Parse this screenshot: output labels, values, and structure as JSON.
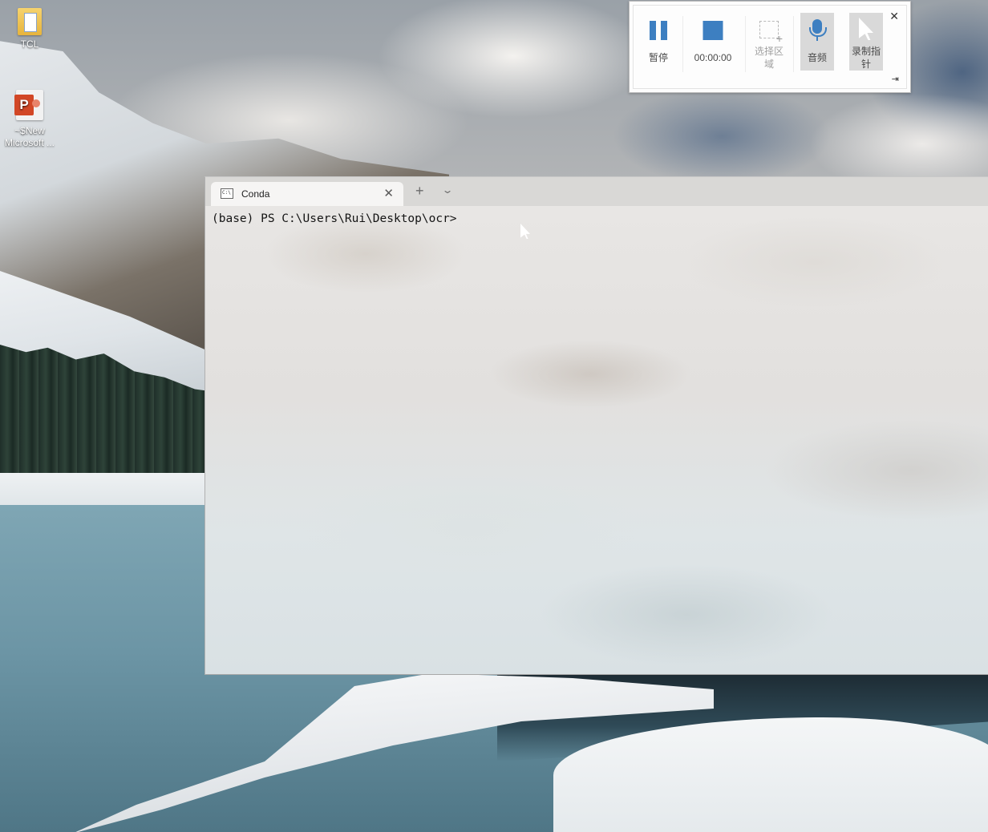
{
  "desktop": {
    "icons": [
      {
        "label": "TCL"
      },
      {
        "label_line1": "~$New",
        "label_line2": "Microsoft ..."
      }
    ]
  },
  "recorder": {
    "pause_label": "暂停",
    "timer": "00:00:00",
    "select_region_line1": "选择区",
    "select_region_line2": "域",
    "audio_label": "音频",
    "record_pointer_line1": "录制指",
    "record_pointer_line2": "针",
    "close_glyph": "✕",
    "pin_glyph": "⇥"
  },
  "terminal": {
    "tab_title": "Conda",
    "tab_icon_text": "C:\\",
    "tab_close_glyph": "✕",
    "new_tab_glyph": "+",
    "dropdown_glyph": "⌄",
    "prompt": "(base) PS C:\\Users\\Rui\\Desktop\\ocr>"
  }
}
